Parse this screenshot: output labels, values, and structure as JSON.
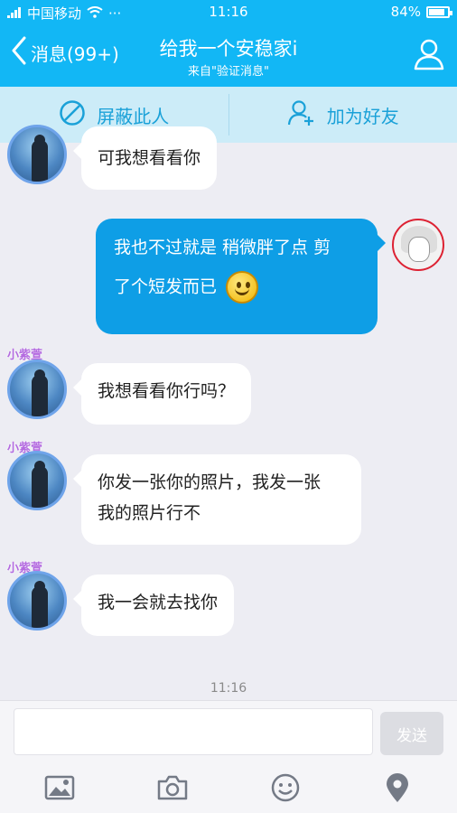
{
  "status": {
    "carrier": "中国移动",
    "dots": "···",
    "time": "11:16",
    "battery": "84%",
    "battery_level": 0.84
  },
  "nav": {
    "back_label": "消息(99+)",
    "title": "给我一个安稳家i",
    "subtitle": "来自\"验证消息\""
  },
  "actions": {
    "block_label": "屏蔽此人",
    "add_friend_label": "加为好友"
  },
  "messages": [
    {
      "side": "left",
      "text": "可我想看看你"
    },
    {
      "side": "right",
      "line1": "我也不过就是 稍微胖了点 剪",
      "line2": "了个短发而已"
    },
    {
      "side": "left",
      "badge": "小紫萱",
      "text": "我想看看你行吗？"
    },
    {
      "side": "left",
      "badge": "小紫萱",
      "line1": "你发一张你的照片，我发一张",
      "line2": "我的照片行不"
    },
    {
      "side": "left",
      "badge": "小紫萱",
      "text": "我一会就去找你"
    }
  ],
  "timestamp": "11:16",
  "composer": {
    "input_value": "",
    "send_label": "发送"
  },
  "colors": {
    "brand": "#12b7f5",
    "bubble_sent": "#0e9ee6",
    "bubble_received": "#ffffff",
    "action_bar": "#ccecf8"
  },
  "icons": [
    "back-chevron-icon",
    "profile-icon",
    "block-icon",
    "add-friend-icon",
    "image-icon",
    "camera-icon",
    "emoji-icon",
    "location-icon"
  ]
}
